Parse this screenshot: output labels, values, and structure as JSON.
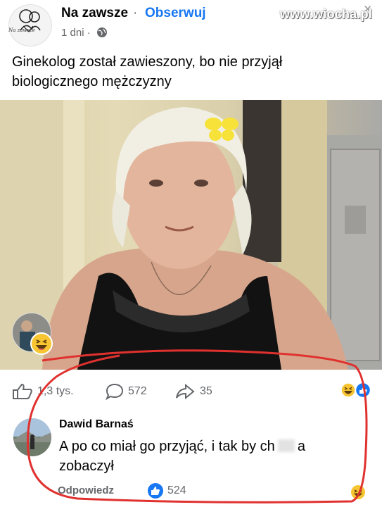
{
  "post": {
    "page_name": "Na zawsze",
    "separator": "·",
    "follow_label": "Obserwuj",
    "time": "1 dni ·",
    "avatar_caption": "Na zawsze",
    "watermark": "www.wiocha.pl",
    "text": "Ginekolog został zawieszony, bo nie przyjął biologicznego mężczyzny"
  },
  "actions": {
    "likes": "1,3 tys.",
    "comments": "572",
    "shares": "35"
  },
  "comment": {
    "author": "Dawid Barnaś",
    "text_start": "A po co miał go przyjąć, i tak by ch",
    "text_end": "a zobaczył",
    "reply_label": "Odpowiedz",
    "likes": "524"
  },
  "colors": {
    "accent": "#1877f2",
    "secondary_text": "#65676b",
    "annotation": "#e0312f"
  },
  "icons": [
    "globe-icon",
    "like-icon",
    "comment-icon",
    "share-icon",
    "haha-reaction-icon",
    "like-reaction-icon"
  ]
}
